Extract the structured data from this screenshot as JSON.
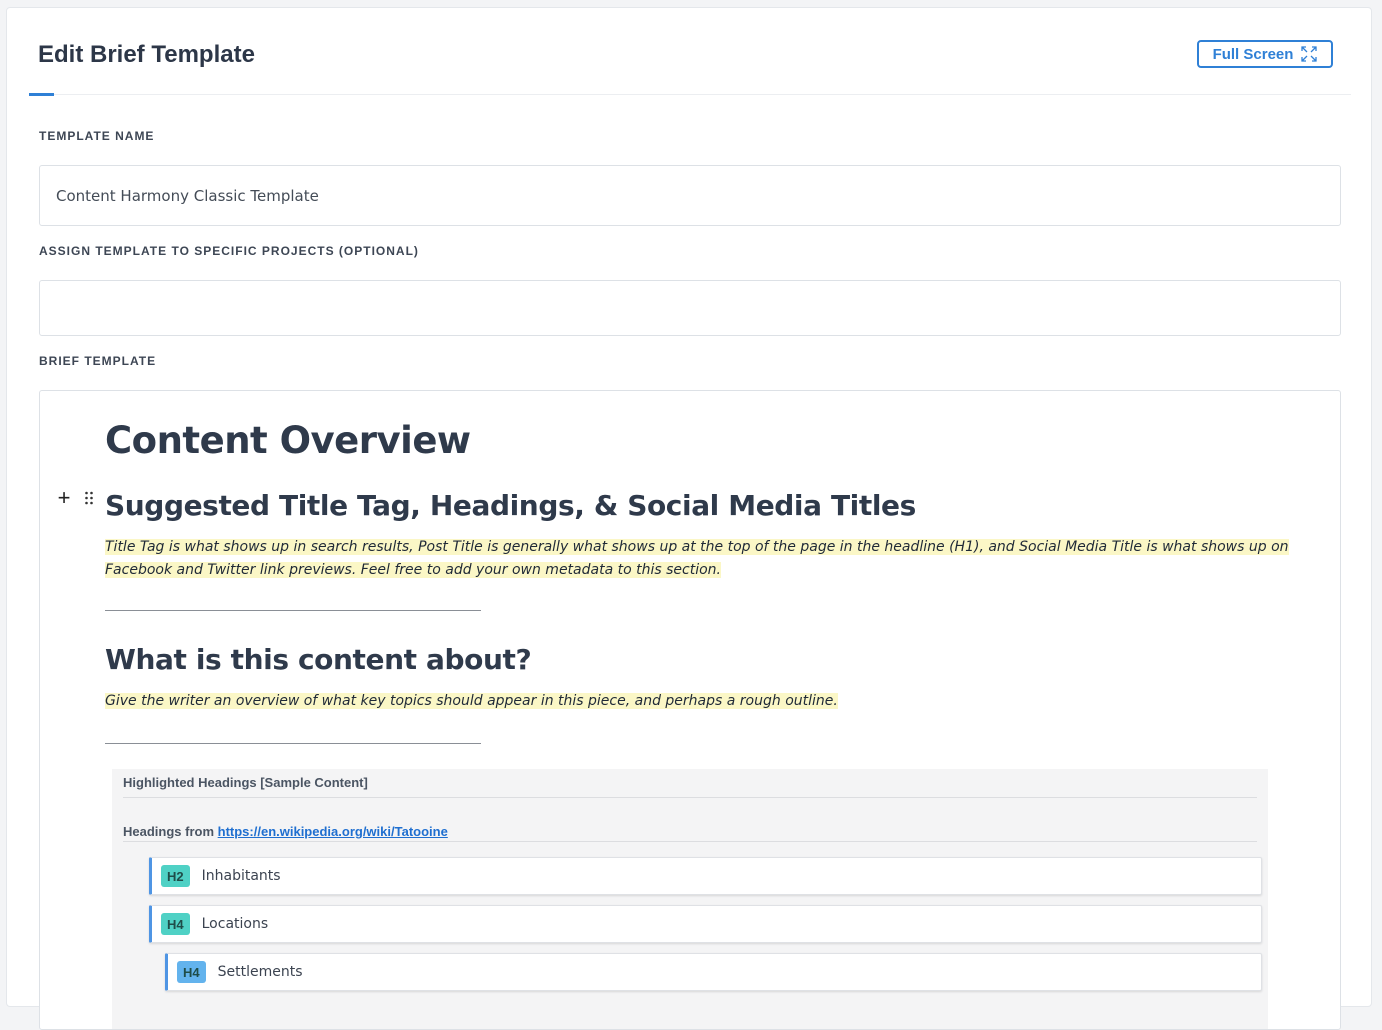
{
  "header": {
    "title": "Edit Brief Template",
    "fullscreen_label": "Full Screen",
    "fullscreen_icon": "expand-arrows-icon"
  },
  "form": {
    "template_name": {
      "label": "TEMPLATE NAME",
      "value": "Content Harmony Classic Template"
    },
    "assign_projects": {
      "label": "ASSIGN TEMPLATE TO SPECIFIC PROJECTS (OPTIONAL)",
      "value": ""
    },
    "brief_template": {
      "label": "BRIEF TEMPLATE"
    }
  },
  "editor": {
    "heading_1": "Content Overview",
    "section_1": {
      "heading": "Suggested Title Tag, Headings, & Social Media Titles",
      "note_line_1": "Title Tag is what shows up in search results, Post Title is generally what shows up at the top of the page in the headline (H1), and Social Media Title is what shows up on",
      "note_line_2": "Facebook and Twitter link previews. Feel free to add your own metadata to this section."
    },
    "section_2": {
      "heading": "What is this content about?",
      "note": "Give the writer an overview of what key topics should appear in this piece, and perhaps a rough outline."
    },
    "highlighted_headings": {
      "title": "Highlighted Headings [Sample Content]",
      "source_prefix": "Headings from",
      "source_link": "https://en.wikipedia.org/wiki/Tatooine",
      "items": [
        {
          "tag": "H2",
          "text": "Inhabitants",
          "color": "#4fd1c5"
        },
        {
          "tag": "H4",
          "text": "Locations",
          "color": "#4fd1c5"
        },
        {
          "tag": "H4",
          "text": "Settlements",
          "color": "#63b3ed"
        }
      ]
    }
  },
  "colors": {
    "accent": "#2f80d6",
    "highlight": "#fbf7c6"
  }
}
